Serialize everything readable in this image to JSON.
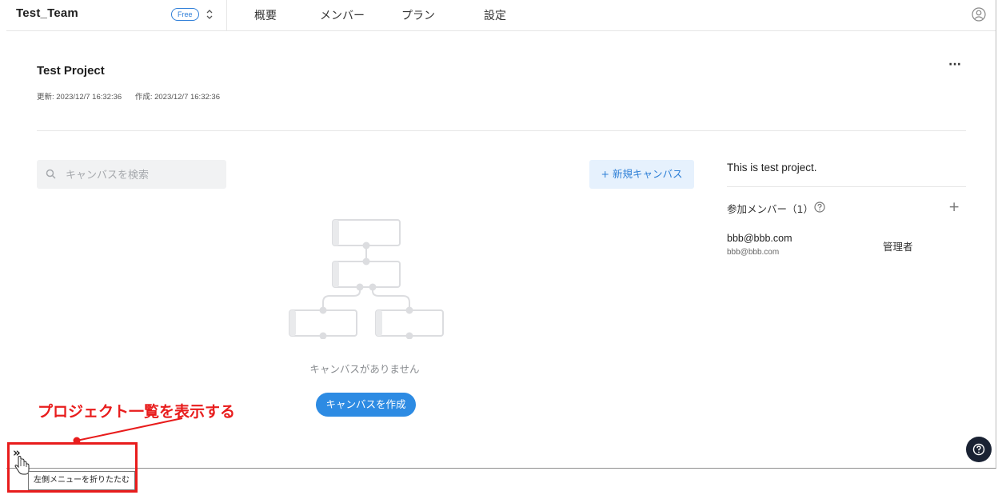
{
  "header": {
    "team_name": "Test_Team",
    "plan_badge": "Free",
    "tabs": [
      "概要",
      "メンバー",
      "プラン",
      "設定"
    ]
  },
  "project": {
    "title": "Test Project",
    "updated": "更新: 2023/12/7 16:32:36",
    "created": "作成: 2023/12/7 16:32:36",
    "description": "This is test project."
  },
  "canvases": {
    "search_placeholder": "キャンバスを検索",
    "new_button": "+ 新規キャンバス",
    "empty_message": "キャンバスがありません",
    "create_button": "キャンバスを作成"
  },
  "members": {
    "heading": "参加メンバー（1）",
    "list": [
      {
        "name": "bbb@bbb.com",
        "email": "bbb@bbb.com",
        "role": "管理者"
      }
    ]
  },
  "sidebar": {
    "toggle_label": "»",
    "tooltip": "左側メニューを折りたたむ"
  },
  "annotation": {
    "text": "プロジェクト一覧を表示する",
    "color": "#e81c1c"
  },
  "colors": {
    "accent": "#2d8be3",
    "help_fab": "#1a2233"
  }
}
